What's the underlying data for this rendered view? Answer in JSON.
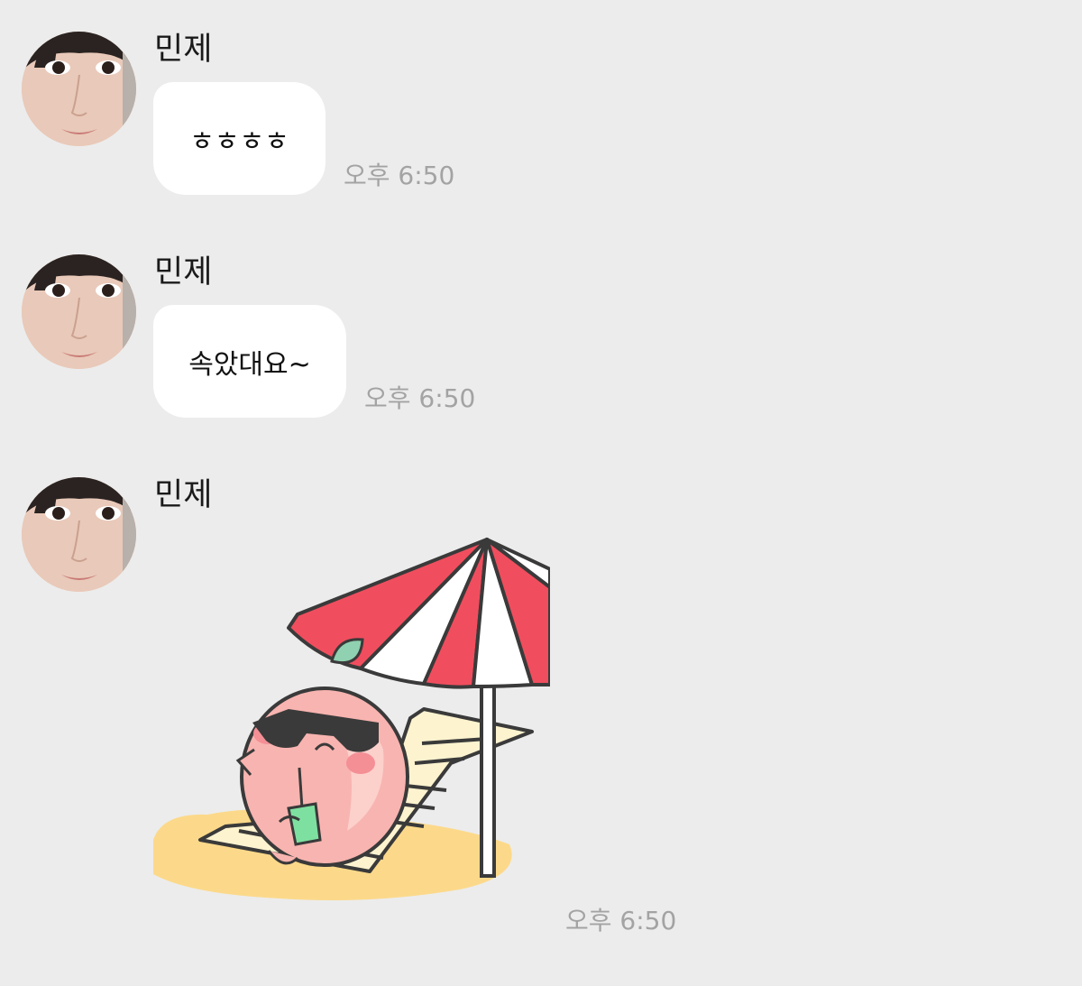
{
  "messages": [
    {
      "sender": "민제",
      "text": "ㅎㅎㅎㅎ",
      "time": "오후 6:50"
    },
    {
      "sender": "민제",
      "text": "속았대요~",
      "time": "오후 6:50"
    },
    {
      "sender": "민제",
      "sticker": "peach-character-relaxing-under-beach-umbrella",
      "time": "오후 6:50"
    }
  ],
  "colors": {
    "background": "#ececec",
    "bubble": "#ffffff",
    "timestamp": "#a3a3a3",
    "umbrella_red": "#f04e5e",
    "peach_pink": "#f8b4b0",
    "sand": "#fcd98a"
  }
}
